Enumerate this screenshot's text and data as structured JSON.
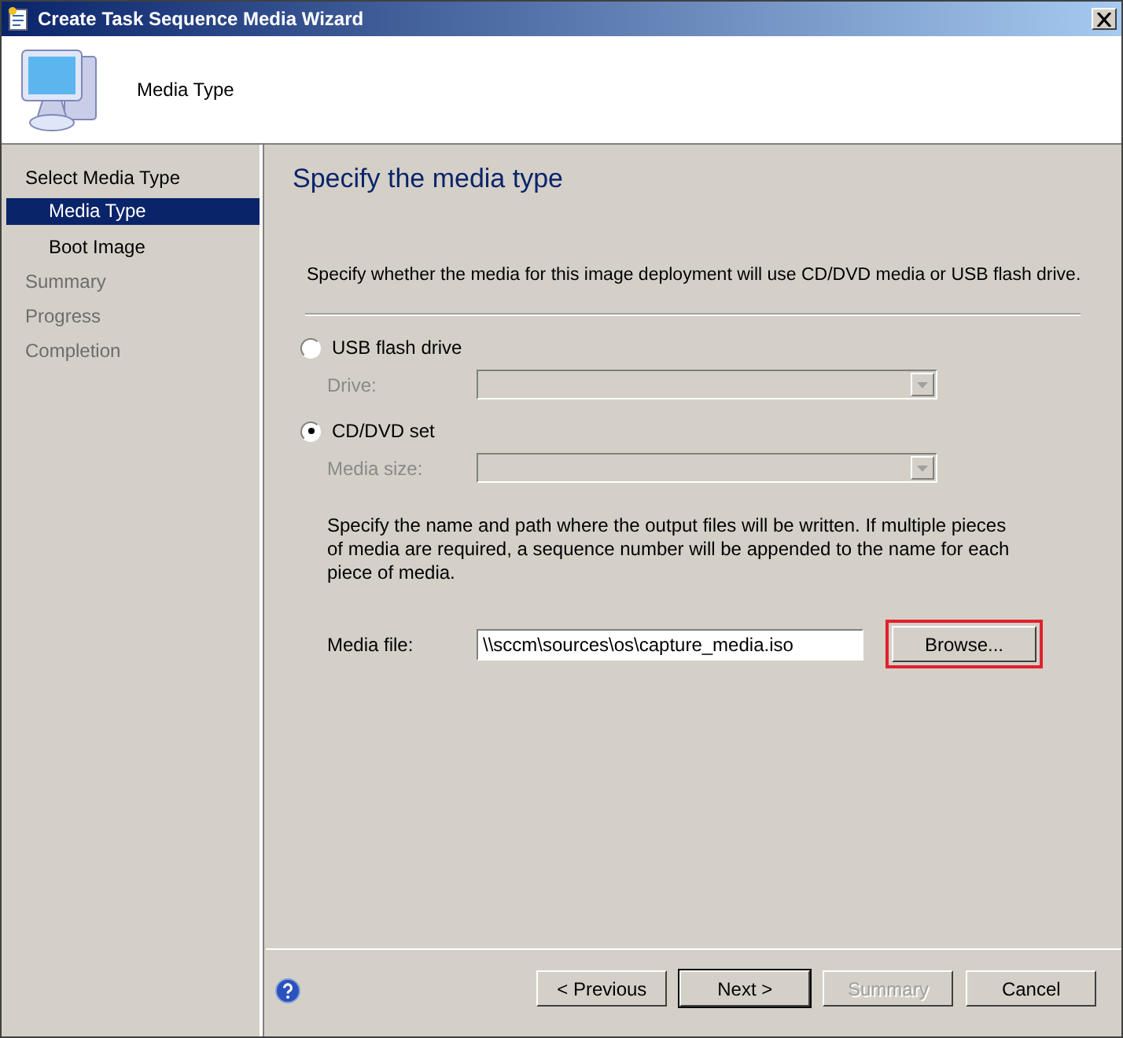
{
  "window": {
    "title": "Create Task Sequence Media Wizard"
  },
  "header": {
    "title": "Media Type"
  },
  "sidebar": {
    "items": [
      {
        "label": "Select Media Type",
        "selected": false,
        "disabled": false,
        "children": [
          {
            "label": "Media Type",
            "selected": true,
            "disabled": false
          },
          {
            "label": "Boot Image",
            "selected": false,
            "disabled": false
          }
        ]
      },
      {
        "label": "Summary",
        "selected": false,
        "disabled": true
      },
      {
        "label": "Progress",
        "selected": false,
        "disabled": true
      },
      {
        "label": "Completion",
        "selected": false,
        "disabled": true
      }
    ]
  },
  "page": {
    "heading": "Specify the media type",
    "description": "Specify whether the media for this image deployment will use CD/DVD media or USB flash drive.",
    "options": [
      {
        "label": "USB flash drive",
        "selected": false,
        "field": {
          "label": "Drive:",
          "disabled": true
        }
      },
      {
        "label": "CD/DVD set",
        "selected": true,
        "field": {
          "label": "Media size:",
          "disabled": true
        }
      }
    ],
    "note": "Specify the name and path where the output files will be written.  If multiple pieces of media are required, a sequence number will be appended to the name for each piece of media.",
    "media_file": {
      "label": "Media file:",
      "value": "\\\\sccm\\sources\\os\\capture_media.iso",
      "button": "Browse...",
      "highlighted": true
    }
  },
  "buttons": [
    {
      "label": "< Previous",
      "disabled": false,
      "default": false
    },
    {
      "label": "Next >",
      "disabled": false,
      "default": true
    },
    {
      "label": "Summary",
      "disabled": true,
      "default": false
    },
    {
      "label": "Cancel",
      "disabled": false,
      "default": false
    }
  ]
}
